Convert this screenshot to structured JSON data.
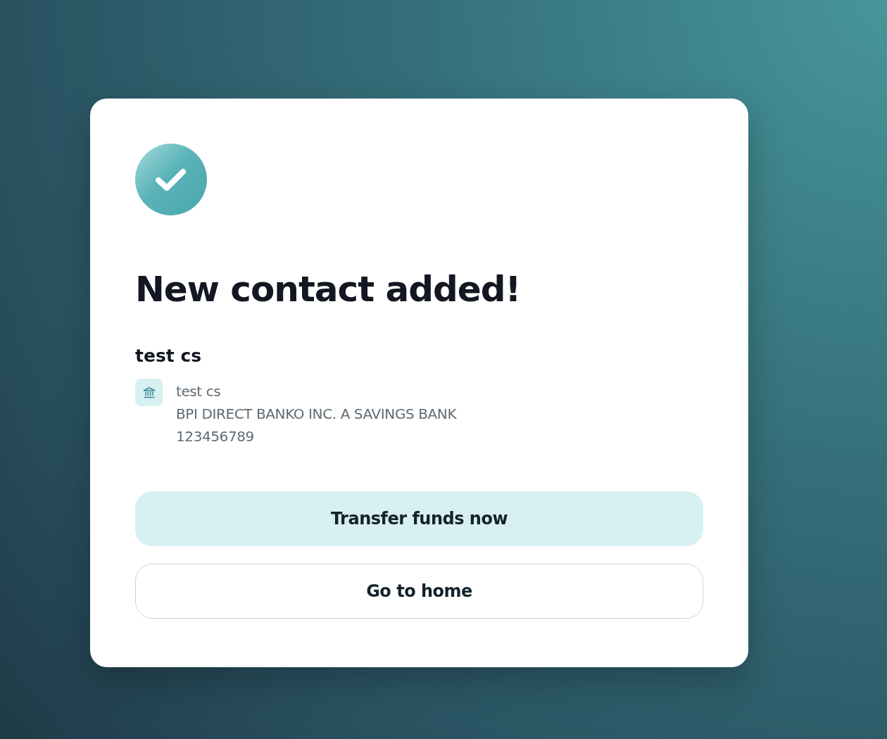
{
  "title": "New contact added!",
  "contact": {
    "name": "test cs",
    "details": [
      "test cs",
      "BPI DIRECT BANKO INC. A SAVINGS BANK",
      "123456789"
    ]
  },
  "buttons": [
    {
      "label": "Transfer funds now",
      "kind": "primary"
    },
    {
      "label": "Go to home",
      "kind": "secondary"
    }
  ]
}
